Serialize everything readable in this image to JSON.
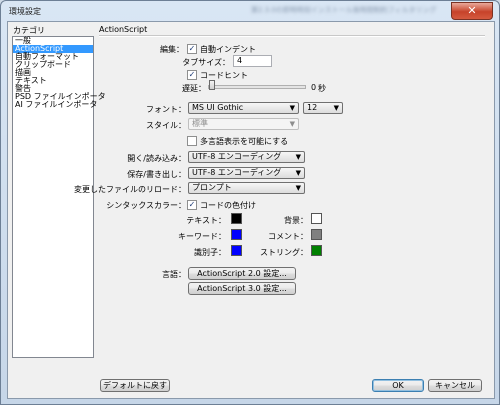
{
  "window": {
    "title": "環境設定",
    "blurred_title": "第2.3.0の即時時刻インストール後時間制約フィルタリング",
    "close_glyph": "✕"
  },
  "categories": {
    "label": "カテゴリ",
    "items": [
      "一般",
      "ActionScript",
      "自動フォーマット",
      "クリップボード",
      "描画",
      "テキスト",
      "警告",
      "PSD ファイルインポータ",
      "AI ファイルインポータ"
    ],
    "selected_index": 1
  },
  "panel": {
    "title": "ActionScript",
    "editing": {
      "label": "編集：",
      "auto_indent": {
        "label": "自動インデント",
        "checked": true
      },
      "tab_size_label": "タブサイズ：",
      "tab_size_value": "4",
      "code_hint": {
        "label": "コードヒント",
        "checked": true
      },
      "delay_label": "遅延：",
      "delay_value": "0",
      "delay_unit": "秒",
      "delay_fraction": 0
    },
    "font": {
      "label": "フォント：",
      "family": "MS UI Gothic",
      "size": "12"
    },
    "style": {
      "label": "スタイル：",
      "value": "標準",
      "disabled": true
    },
    "multilang": {
      "label": "多言語表示を可能にする",
      "checked": false
    },
    "open_import": {
      "label": "開く/読み込み：",
      "value": "UTF-8 エンコーディング"
    },
    "save_export": {
      "label": "保存/書き出し：",
      "value": "UTF-8 エンコーディング"
    },
    "reload": {
      "label": "変更したファイルのリロード：",
      "value": "プロンプト"
    },
    "syntax": {
      "label": "シンタックスカラー：",
      "code_color": {
        "label": "コードの色付け",
        "checked": true
      },
      "text_label": "テキスト：",
      "text_color": "#000000",
      "background_label": "背景：",
      "background_color": "#ffffff",
      "keyword_label": "キーワード：",
      "keyword_color": "#0000ff",
      "comment_label": "コメント：",
      "comment_color": "#808080",
      "identifier_label": "識別子：",
      "identifier_color": "#0000ff",
      "string_label": "ストリング：",
      "string_color": "#008000"
    },
    "language": {
      "label": "言語：",
      "as2_button": "ActionScript 2.0 設定...",
      "as3_button": "ActionScript 3.0 設定..."
    }
  },
  "footer": {
    "reset_button": "デフォルトに戻す",
    "ok_button": "OK",
    "cancel_button": "キャンセル"
  }
}
